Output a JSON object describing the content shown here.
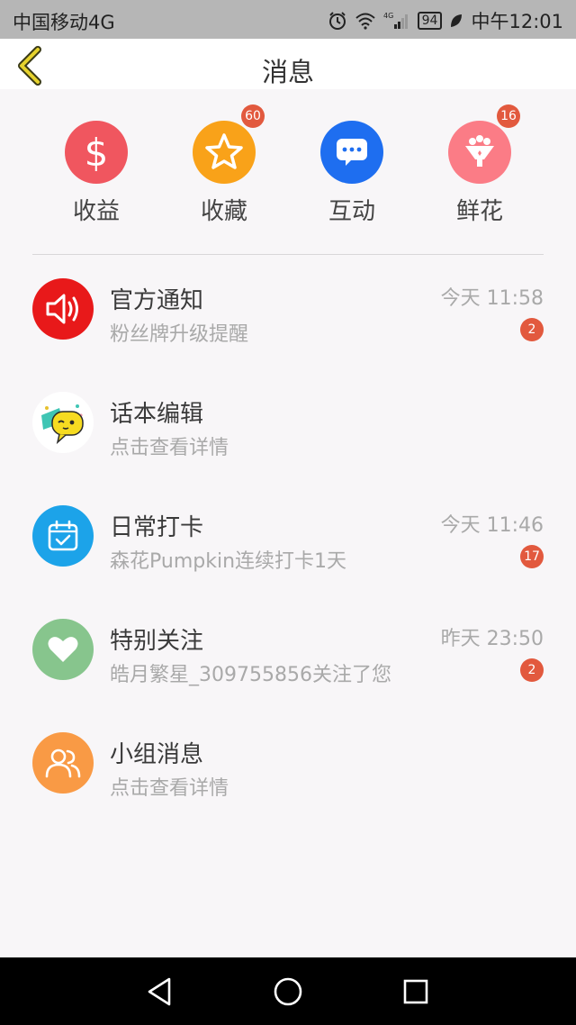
{
  "status_bar": {
    "carrier": "中国移动4G",
    "network": "4G",
    "battery": "94",
    "time": "中午12:01"
  },
  "nav": {
    "title": "消息",
    "back_icon": "chevron-left-icon"
  },
  "quick": [
    {
      "label": "收益",
      "icon": "dollar-icon",
      "color": "#f0565f",
      "badge": ""
    },
    {
      "label": "收藏",
      "icon": "star-icon",
      "color": "#f9a219",
      "badge": "60"
    },
    {
      "label": "互动",
      "icon": "chat-bubble-icon",
      "color": "#1e6ef0",
      "badge": ""
    },
    {
      "label": "鲜花",
      "icon": "flower-bouquet-icon",
      "color": "#fb7c86",
      "badge": "16"
    }
  ],
  "messages": [
    {
      "title": "官方通知",
      "subtitle": "粉丝牌升级提醒",
      "time": "今天 11:58",
      "badge": "2",
      "icon": "speaker-icon",
      "color": "#e8191a"
    },
    {
      "title": "话本编辑",
      "subtitle": "点击查看详情",
      "time": "",
      "badge": "",
      "icon": "editor-chat-avatar-icon",
      "color": "#ffffff"
    },
    {
      "title": "日常打卡",
      "subtitle": "森花Pumpkin连续打卡1天",
      "time": "今天 11:46",
      "badge": "17",
      "icon": "calendar-check-icon",
      "color": "#1ca3e9"
    },
    {
      "title": "特别关注",
      "subtitle": "皓月繁星_309755856关注了您",
      "time": "昨天 23:50",
      "badge": "2",
      "icon": "heart-icon",
      "color": "#87c58d"
    },
    {
      "title": "小组消息",
      "subtitle": "点击查看详情",
      "time": "",
      "badge": "",
      "icon": "group-icon",
      "color": "#f99a45"
    }
  ],
  "system_nav": {
    "back": "back-triangle-icon",
    "home": "home-circle-icon",
    "recents": "recents-square-icon"
  }
}
